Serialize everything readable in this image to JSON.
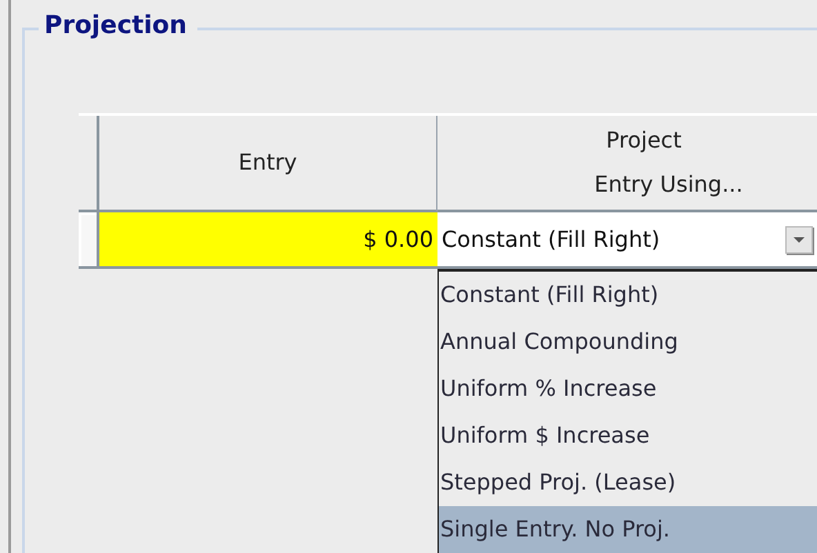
{
  "group": {
    "title": "Projection"
  },
  "table": {
    "columns": [
      "Entry",
      "Project\nEntry Using..."
    ],
    "rows": [
      {
        "entry": "$ 0.00",
        "method": "Constant (Fill Right)"
      }
    ]
  },
  "dropdown": {
    "expanded": true,
    "options": [
      {
        "label": "Constant (Fill Right)",
        "selected": false
      },
      {
        "label": "Annual Compounding",
        "selected": false
      },
      {
        "label": "Uniform % Increase",
        "selected": false
      },
      {
        "label": "Uniform $ Increase",
        "selected": false
      },
      {
        "label": "Stepped Proj. (Lease)",
        "selected": false
      },
      {
        "label": "Single Entry. No Proj.",
        "selected": true
      }
    ]
  }
}
